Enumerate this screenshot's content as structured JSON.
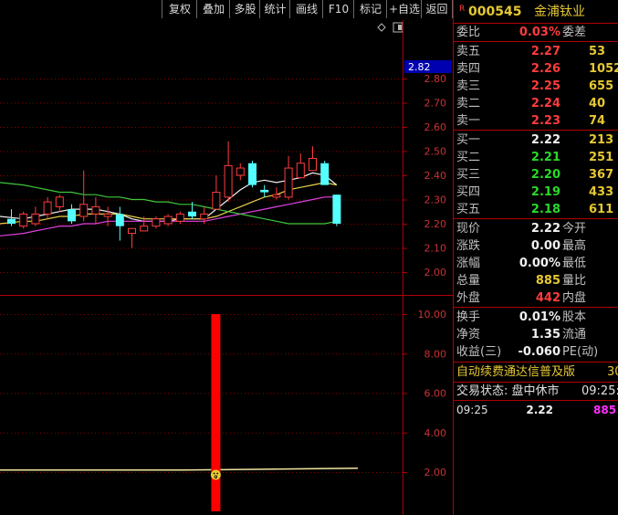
{
  "toolbar": {
    "buttons": [
      "复权",
      "叠加",
      "多股",
      "统计",
      "画线",
      "F10",
      "标记",
      "+自选",
      "返回"
    ]
  },
  "stock": {
    "badge": "R",
    "code": "000545",
    "name": "金浦钛业"
  },
  "price_axis": {
    "ticks": [
      "2.80",
      "2.70",
      "2.60",
      "2.50",
      "2.40",
      "2.30",
      "2.20",
      "2.10",
      "2.00"
    ],
    "current_price_tag": "2.82"
  },
  "volume_axis": {
    "ticks": [
      "10.00",
      "8.00",
      "6.00",
      "4.00",
      "2.00"
    ]
  },
  "order_book": {
    "weibi_label": "委比",
    "weibi_value": "0.03%",
    "weicha_label": "委差",
    "sell": [
      {
        "label": "卖五",
        "price": "2.27",
        "volume": "53"
      },
      {
        "label": "卖四",
        "price": "2.26",
        "volume": "1052"
      },
      {
        "label": "卖三",
        "price": "2.25",
        "volume": "655"
      },
      {
        "label": "卖二",
        "price": "2.24",
        "volume": "40"
      },
      {
        "label": "卖一",
        "price": "2.23",
        "volume": "74"
      }
    ],
    "buy": [
      {
        "label": "买一",
        "price": "2.22",
        "volume": "213"
      },
      {
        "label": "买二",
        "price": "2.21",
        "volume": "251"
      },
      {
        "label": "买三",
        "price": "2.20",
        "volume": "367"
      },
      {
        "label": "买四",
        "price": "2.19",
        "volume": "433"
      },
      {
        "label": "买五",
        "price": "2.18",
        "volume": "611"
      }
    ]
  },
  "quote": {
    "rows": [
      {
        "label": "现价",
        "value": "2.22",
        "label2": "今开"
      },
      {
        "label": "涨跌",
        "value": "0.00",
        "label2": "最高"
      },
      {
        "label": "涨幅",
        "value": "0.00%",
        "label2": "最低"
      },
      {
        "label": "总量",
        "value": "885",
        "label2": "量比"
      },
      {
        "label": "外盘",
        "value": "442",
        "label2": "内盘"
      }
    ],
    "rows2": [
      {
        "label": "换手",
        "value": "0.01%",
        "label2": "股本"
      },
      {
        "label": "净资",
        "value": "1.35",
        "label2": "流通"
      },
      {
        "label": "收益(三)",
        "value": "-0.060",
        "label2": "PE(动)"
      }
    ]
  },
  "notice": {
    "ad_text": "自动续费通达信普及版",
    "ad_trailing": "30",
    "status_text": "交易状态: 盘中休市",
    "status_time": "09:25:"
  },
  "ticks": [
    {
      "time": "09:25",
      "price": "2.22",
      "volume": "885"
    }
  ],
  "colors": {
    "up": "#ff3c3c",
    "down": "#54ffff",
    "ma_white": "#f0f0f0",
    "ma_yellow": "#e6d24a",
    "ma_magenta": "#e040e0",
    "ma_green": "#3cc83c",
    "volume_bar": "#ff0000",
    "grid": "#8b0000"
  },
  "chart_data": {
    "type": "candlestick",
    "ylim": [
      1.95,
      2.86
    ],
    "candles": [
      {
        "o": 2.22,
        "h": 2.26,
        "l": 2.19,
        "c": 2.2
      },
      {
        "o": 2.19,
        "h": 2.25,
        "l": 2.18,
        "c": 2.24
      },
      {
        "o": 2.2,
        "h": 2.27,
        "l": 2.19,
        "c": 2.24
      },
      {
        "o": 2.24,
        "h": 2.31,
        "l": 2.22,
        "c": 2.29
      },
      {
        "o": 2.27,
        "h": 2.32,
        "l": 2.25,
        "c": 2.31
      },
      {
        "o": 2.26,
        "h": 2.28,
        "l": 2.2,
        "c": 2.21
      },
      {
        "o": 2.23,
        "h": 2.42,
        "l": 2.21,
        "c": 2.28
      },
      {
        "o": 2.24,
        "h": 2.31,
        "l": 2.2,
        "c": 2.27
      },
      {
        "o": 2.23,
        "h": 2.27,
        "l": 2.19,
        "c": 2.24
      },
      {
        "o": 2.24,
        "h": 2.27,
        "l": 2.13,
        "c": 2.19
      },
      {
        "o": 2.16,
        "h": 2.18,
        "l": 2.1,
        "c": 2.18
      },
      {
        "o": 2.17,
        "h": 2.23,
        "l": 2.17,
        "c": 2.19
      },
      {
        "o": 2.19,
        "h": 2.23,
        "l": 2.18,
        "c": 2.22
      },
      {
        "o": 2.2,
        "h": 2.24,
        "l": 2.19,
        "c": 2.23
      },
      {
        "o": 2.21,
        "h": 2.25,
        "l": 2.2,
        "c": 2.24
      },
      {
        "o": 2.25,
        "h": 2.29,
        "l": 2.22,
        "c": 2.23
      },
      {
        "o": 2.22,
        "h": 2.27,
        "l": 2.2,
        "c": 2.24
      },
      {
        "o": 2.26,
        "h": 2.4,
        "l": 2.26,
        "c": 2.33
      },
      {
        "o": 2.31,
        "h": 2.54,
        "l": 2.29,
        "c": 2.44
      },
      {
        "o": 2.4,
        "h": 2.45,
        "l": 2.38,
        "c": 2.43
      },
      {
        "o": 2.45,
        "h": 2.46,
        "l": 2.35,
        "c": 2.36
      },
      {
        "o": 2.34,
        "h": 2.36,
        "l": 2.31,
        "c": 2.33
      },
      {
        "o": 2.31,
        "h": 2.35,
        "l": 2.3,
        "c": 2.32
      },
      {
        "o": 2.31,
        "h": 2.48,
        "l": 2.3,
        "c": 2.43
      },
      {
        "o": 2.39,
        "h": 2.49,
        "l": 2.39,
        "c": 2.45
      },
      {
        "o": 2.42,
        "h": 2.52,
        "l": 2.42,
        "c": 2.47
      },
      {
        "o": 2.45,
        "h": 2.46,
        "l": 2.36,
        "c": 2.36
      },
      {
        "o": 2.32,
        "h": 2.32,
        "l": 2.19,
        "c": 2.2
      }
    ],
    "ma": [
      {
        "name": "white",
        "values": [
          2.23,
          2.22,
          2.23,
          2.24,
          2.25,
          2.26,
          2.26,
          2.26,
          2.25,
          2.24,
          2.22,
          2.21,
          2.21,
          2.21,
          2.22,
          2.22,
          2.22,
          2.26,
          2.3,
          2.34,
          2.37,
          2.38,
          2.37,
          2.38,
          2.39,
          2.41,
          2.4,
          2.36
        ]
      },
      {
        "name": "yellow",
        "values": [
          2.2,
          2.21,
          2.21,
          2.22,
          2.23,
          2.23,
          2.24,
          2.24,
          2.24,
          2.24,
          2.23,
          2.22,
          2.22,
          2.22,
          2.22,
          2.22,
          2.22,
          2.23,
          2.25,
          2.27,
          2.29,
          2.31,
          2.32,
          2.34,
          2.35,
          2.36,
          2.37,
          2.36
        ]
      },
      {
        "name": "magenta",
        "values": [
          2.15,
          2.16,
          2.17,
          2.18,
          2.19,
          2.19,
          2.2,
          2.2,
          2.21,
          2.21,
          2.21,
          2.21,
          2.21,
          2.21,
          2.21,
          2.21,
          2.21,
          2.22,
          2.23,
          2.24,
          2.25,
          2.26,
          2.27,
          2.28,
          2.29,
          2.3,
          2.31,
          2.31
        ]
      },
      {
        "name": "green",
        "values": [
          2.37,
          2.36,
          2.35,
          2.34,
          2.33,
          2.33,
          2.32,
          2.32,
          2.31,
          2.31,
          2.3,
          2.3,
          2.29,
          2.29,
          2.28,
          2.28,
          2.27,
          2.26,
          2.25,
          2.24,
          2.23,
          2.22,
          2.21,
          2.2,
          2.2,
          2.2,
          2.2,
          2.21
        ]
      }
    ],
    "volume": {
      "ylim": [
        0,
        10.8
      ],
      "spike_value": 10.0,
      "spike_index": 17,
      "baseline": 2.15
    }
  }
}
